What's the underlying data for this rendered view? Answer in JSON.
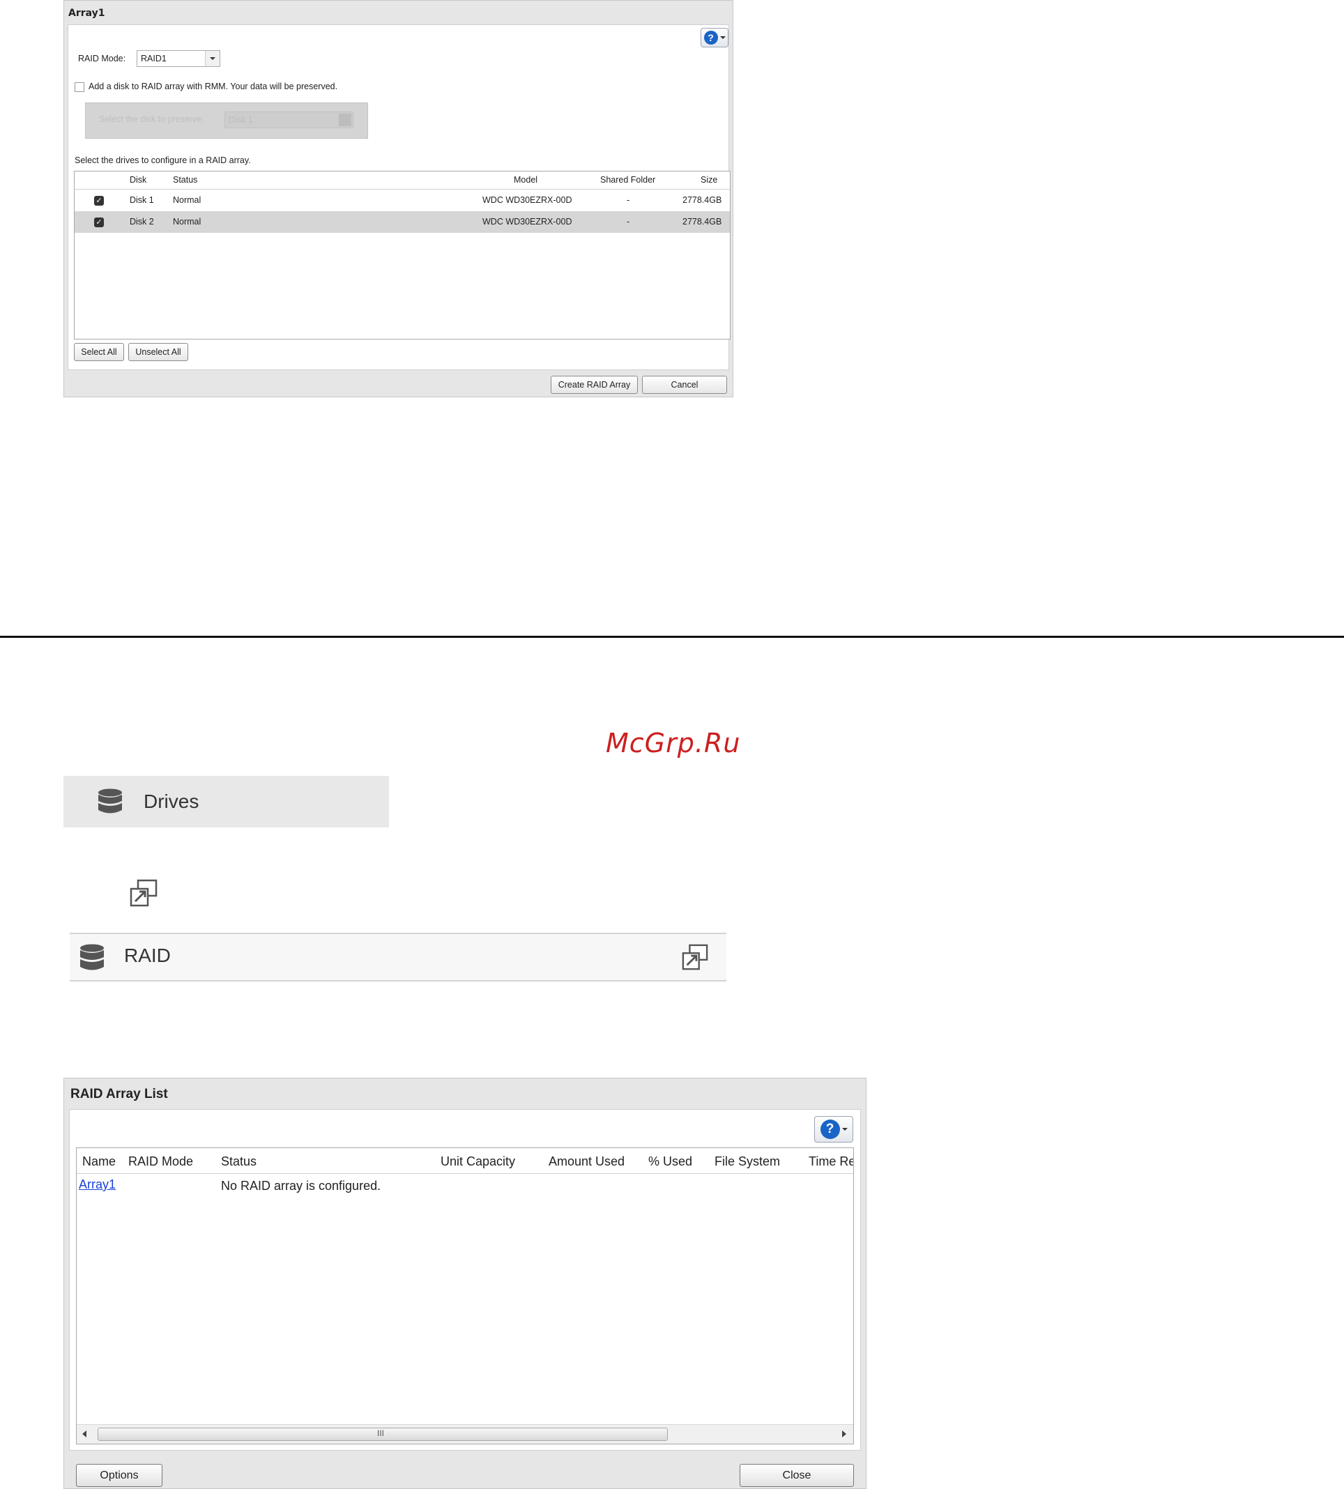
{
  "array_dialog": {
    "title": "Array1",
    "raid_mode_label": "RAID Mode:",
    "raid_mode_value": "RAID1",
    "rmm_checkbox_label": "Add a disk to RAID array with RMM. Your data will be preserved.",
    "preserve_label": "Select the disk to preserve:",
    "preserve_value": "Disk 1",
    "instruction": "Select the drives to configure in a RAID array.",
    "columns": {
      "disk": "Disk",
      "status": "Status",
      "model": "Model",
      "shared_folder": "Shared Folder",
      "size": "Size"
    },
    "rows": [
      {
        "checked": true,
        "disk": "Disk 1",
        "status": "Normal",
        "model": "WDC WD30EZRX-00D",
        "shared_folder": "-",
        "size": "2778.4GB"
      },
      {
        "checked": true,
        "disk": "Disk 2",
        "status": "Normal",
        "model": "WDC WD30EZRX-00D",
        "shared_folder": "-",
        "size": "2778.4GB"
      }
    ],
    "select_all": "Select All",
    "unselect_all": "Unselect All",
    "create_button": "Create RAID Array",
    "cancel_button": "Cancel"
  },
  "watermark": "McGrp.Ru",
  "drives_bar": {
    "label": "Drives",
    "icon": "database-icon"
  },
  "expand_icon": "open-window-icon",
  "raid_bar": {
    "label": "RAID",
    "icon": "database-icon",
    "action_icon": "open-window-icon"
  },
  "raid_list_dialog": {
    "title": "RAID Array List",
    "columns": [
      "Name",
      "RAID Mode",
      "Status",
      "Unit Capacity",
      "Amount Used",
      "% Used",
      "File System",
      "Time Re"
    ],
    "rows": [
      {
        "name": "Array1",
        "raid_mode": "",
        "status": "No RAID array is configured."
      }
    ],
    "scroll_grip": "III",
    "options_button": "Options",
    "close_button": "Close"
  },
  "colors": {
    "link": "#1a3fd6",
    "help_blue": "#1a64c8",
    "watermark_red": "#cc2020",
    "selected_row": "#d6d6d6"
  }
}
